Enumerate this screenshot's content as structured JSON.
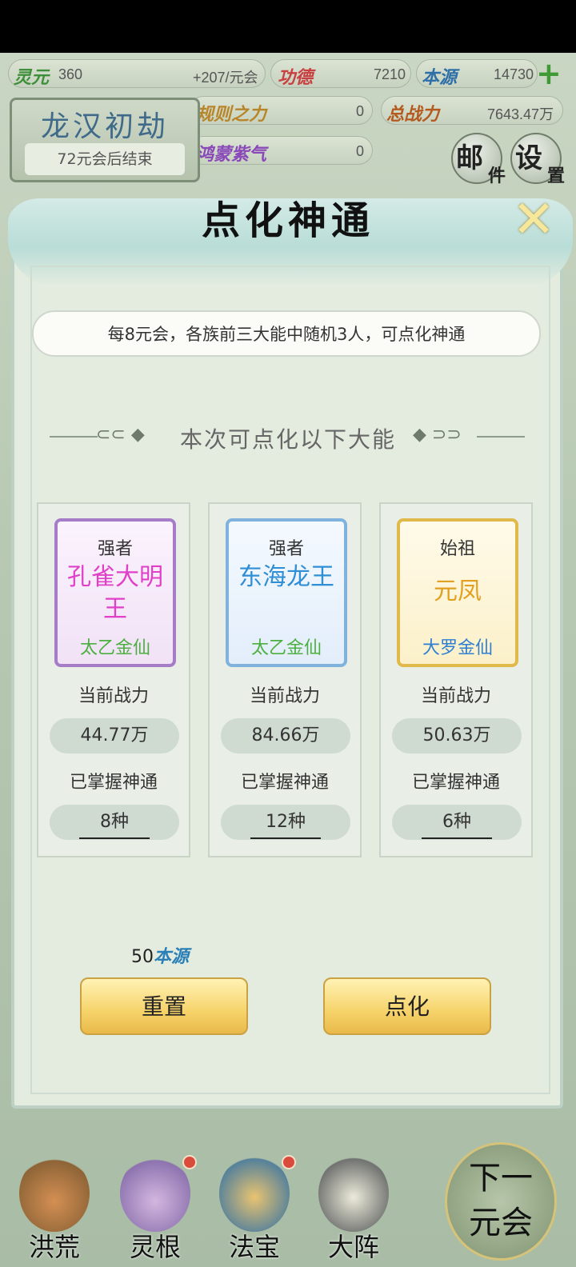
{
  "resources": {
    "lingyuan": {
      "label": "灵元",
      "value": "360",
      "rate": "+207/元会"
    },
    "gongde": {
      "label": "功德",
      "value": "7210"
    },
    "benyuan": {
      "label": "本源",
      "value": "14730"
    },
    "guize": {
      "label": "规则之力",
      "value": "0"
    },
    "zhanli": {
      "label": "总战力",
      "value": "7643.47万"
    },
    "hongmeng": {
      "label": "鸿蒙紫气",
      "value": "0"
    }
  },
  "era": {
    "title": "龙汉初劫",
    "subtitle": "72元会后结束"
  },
  "top_buttons": {
    "mail": {
      "big": "邮",
      "small": "件"
    },
    "settings": {
      "big": "设",
      "small": "置"
    }
  },
  "modal": {
    "title": "点化神通",
    "close_icon": "✕",
    "notice": "每8元会，各族前三大能中随机3人，可点化神通",
    "section_title": "本次可点化以下大能",
    "stat_power_label": "当前战力",
    "stat_skills_label": "已掌握神通",
    "cards": [
      {
        "rank": "强者",
        "name": "孔雀大明王",
        "realm": "太乙金仙",
        "power": "44.77万",
        "skills": "8种",
        "name_color": "#e040c8",
        "realm_color": "#4caf3f",
        "frame": "purple"
      },
      {
        "rank": "强者",
        "name": "东海龙王",
        "realm": "太乙金仙",
        "power": "84.66万",
        "skills": "12种",
        "name_color": "#2f8fd6",
        "realm_color": "#4caf3f",
        "frame": "blue"
      },
      {
        "rank": "始祖",
        "name": "元凤",
        "realm": "大罗金仙",
        "power": "50.63万",
        "skills": "6种",
        "name_color": "#e2a020",
        "realm_color": "#2f7fd0",
        "frame": "gold"
      }
    ],
    "cost": {
      "amount": "50",
      "unit": "本源"
    },
    "reset_label": "重置",
    "enlighten_label": "点化"
  },
  "bottom_nav": [
    {
      "label": "洪荒",
      "icon": "mountain-icon",
      "badge": false
    },
    {
      "label": "灵根",
      "icon": "lotus-icon",
      "badge": true
    },
    {
      "label": "法宝",
      "icon": "treasure-icon",
      "badge": true
    },
    {
      "label": "大阵",
      "icon": "formation-icon",
      "badge": false
    }
  ],
  "next_button": {
    "line1": "下一",
    "line2": "元会"
  }
}
